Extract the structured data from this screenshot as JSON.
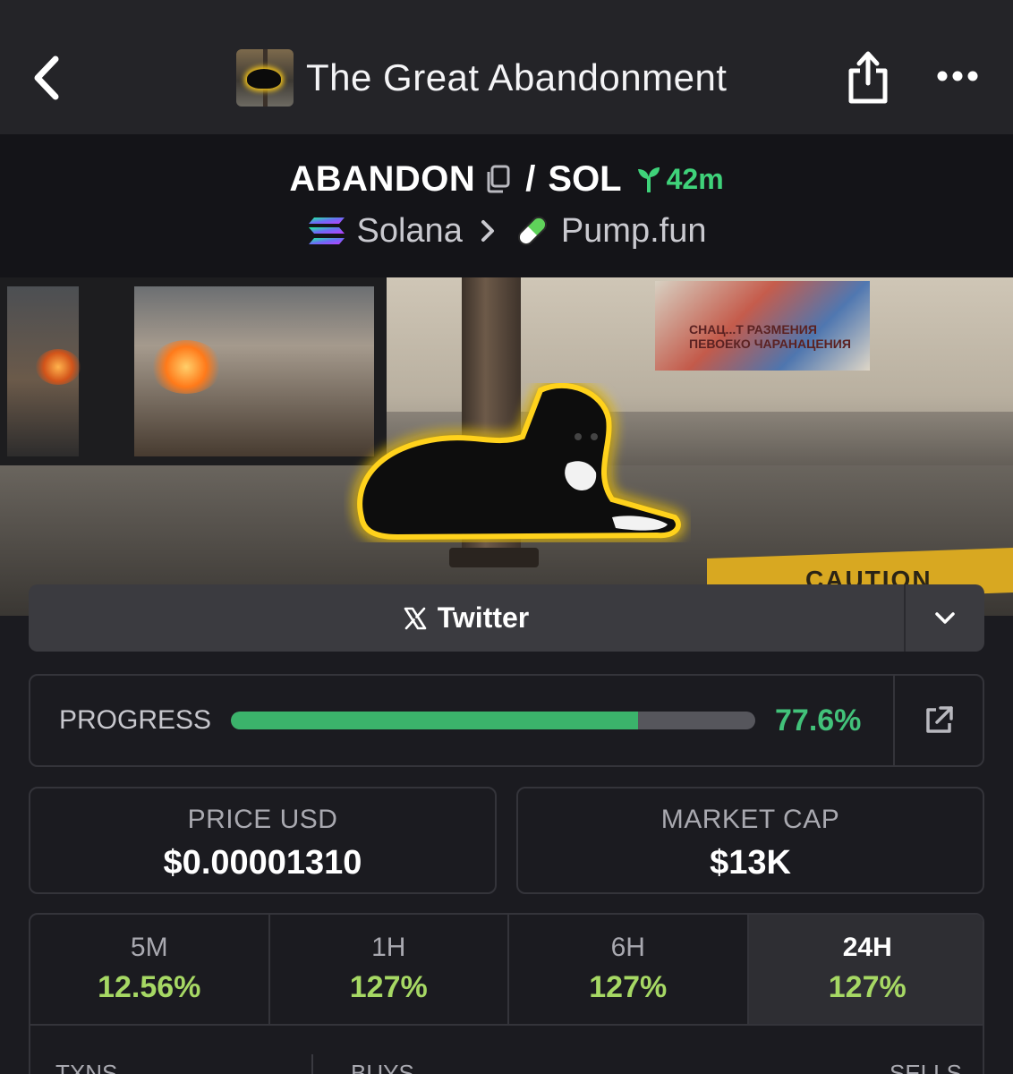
{
  "header": {
    "title": "The Great Abandonment"
  },
  "pair": {
    "base_symbol": "ABANDON",
    "separator": "/",
    "quote_symbol": "SOL",
    "age": "42m",
    "chain": "Solana",
    "dex": "Pump.fun"
  },
  "banner": {
    "poster_text": "СНАЦ...Т РАЗМЕНИЯ ПЕВОЕКО ЧАРАНАЦЕНИЯ",
    "curb_text": "CAUTION"
  },
  "links": {
    "twitter_label": "Twitter"
  },
  "progress": {
    "label": "PROGRESS",
    "value_text": "77.6%",
    "fraction": 0.776
  },
  "stats": {
    "price_label": "PRICE USD",
    "price_value": "$0.00001310",
    "mcap_label": "MARKET CAP",
    "mcap_value": "$13K"
  },
  "changes": [
    {
      "label": "5M",
      "value": "12.56%"
    },
    {
      "label": "1H",
      "value": "127%"
    },
    {
      "label": "6H",
      "value": "127%"
    },
    {
      "label": "24H",
      "value": "127%"
    }
  ],
  "txns": {
    "txns_label": "TXNS",
    "buys_label": "BUYS",
    "sells_label": "SELLS"
  },
  "colors": {
    "accent_green": "#3fd27a",
    "change_green": "#a6d864",
    "progress_fill": "#3bb36b",
    "background": "#1b1b20"
  },
  "icons": {
    "back": "chevron-left-icon",
    "share": "share-icon",
    "more": "more-horizontal-icon",
    "copy": "copy-icon",
    "age": "sprout-icon",
    "chain": "solana-icon",
    "dex": "pill-icon",
    "twitter": "x-logo-icon",
    "expand": "chevron-down-icon",
    "external": "external-link-icon"
  }
}
